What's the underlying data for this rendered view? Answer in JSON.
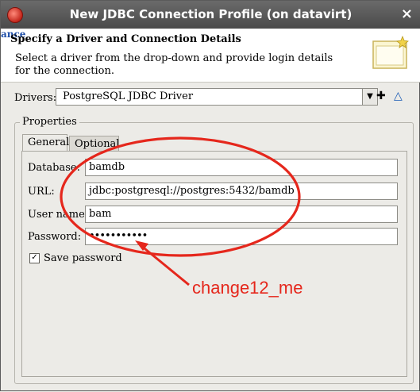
{
  "window": {
    "title": "New JDBC Connection Profile  (on datavirt)",
    "close_glyph": "×"
  },
  "edge": {
    "fragment": "ance"
  },
  "header": {
    "title": "Specify a Driver and Connection Details",
    "description": "Select a driver from the drop-down and provide login details for the connection."
  },
  "drivers": {
    "label": "Drivers:",
    "selected": "PostgreSQL JDBC Driver",
    "new_driver_icon": "new-driver-icon",
    "edit_driver_icon": "edit-driver-icon"
  },
  "properties": {
    "group_label": "Properties",
    "tabs": [
      {
        "label": "General",
        "active": true
      },
      {
        "label": "Optional",
        "active": false
      }
    ],
    "fields": {
      "database": {
        "label": "Database:",
        "value": "bamdb"
      },
      "url": {
        "label": "URL:",
        "value": "jdbc:postgresql://postgres:5432/bamdb"
      },
      "username": {
        "label": "User name:",
        "value": "bam"
      },
      "password": {
        "label": "Password:",
        "value": "•••••••••••"
      }
    },
    "save_password": {
      "label": "Save password",
      "checked": true,
      "mark": "✓"
    }
  },
  "annotation": {
    "text": "change12_me",
    "color": "#e5271c"
  }
}
